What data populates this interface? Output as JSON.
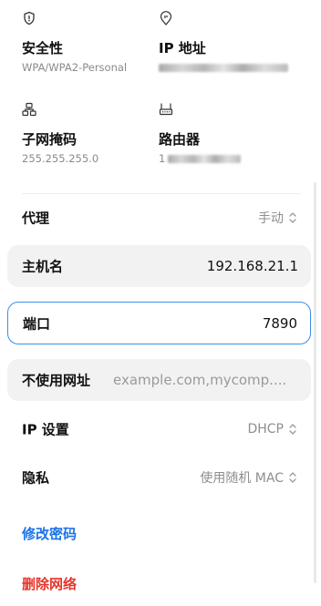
{
  "info": {
    "security": {
      "label": "安全性",
      "value": "WPA/WPA2-Personal"
    },
    "ip": {
      "label": "IP 地址",
      "value": ""
    },
    "subnet": {
      "label": "子网掩码",
      "value": "255.255.255.0"
    },
    "router": {
      "label": "路由器",
      "value": "1"
    }
  },
  "proxy": {
    "label": "代理",
    "value": "手动"
  },
  "hostname": {
    "label": "主机名",
    "value": "192.168.21.1"
  },
  "port": {
    "label": "端口",
    "value": "7890"
  },
  "bypass": {
    "label": "不使用网址",
    "placeholder": "example.com,mycomp...."
  },
  "ip_settings": {
    "label": "IP 设置",
    "value": "DHCP"
  },
  "privacy": {
    "label": "隐私",
    "value": "使用随机 MAC"
  },
  "actions": {
    "change_password": "修改密码",
    "delete_network": "删除网络"
  },
  "colors": {
    "accent": "#1a73e8",
    "danger": "#e5352b",
    "focus_border": "#3a8ee8",
    "field_bg": "#f2f2f2"
  }
}
